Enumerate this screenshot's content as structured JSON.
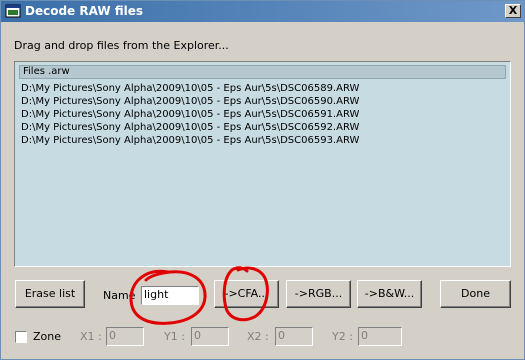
{
  "window": {
    "title": "Decode RAW files",
    "close_glyph": "X"
  },
  "hint": "Drag and drop files from the Explorer...",
  "list": {
    "header": "Files .arw",
    "files": [
      "D:\\My Pictures\\Sony Alpha\\2009\\10\\05 - Eps Aur\\5s\\DSC06589.ARW",
      "D:\\My Pictures\\Sony Alpha\\2009\\10\\05 - Eps Aur\\5s\\DSC06590.ARW",
      "D:\\My Pictures\\Sony Alpha\\2009\\10\\05 - Eps Aur\\5s\\DSC06591.ARW",
      "D:\\My Pictures\\Sony Alpha\\2009\\10\\05 - Eps Aur\\5s\\DSC06592.ARW",
      "D:\\My Pictures\\Sony Alpha\\2009\\10\\05 - Eps Aur\\5s\\DSC06593.ARW"
    ]
  },
  "controls": {
    "erase_label": "Erase list",
    "name_label": "Name",
    "name_value": "light",
    "cfa_label": "->CFA...",
    "rgb_label": "->RGB...",
    "bw_label": "->B&W...",
    "done_label": "Done"
  },
  "zone": {
    "label": "Zone",
    "checked": false,
    "x1_label": "X1 :",
    "x1_value": "0",
    "y1_label": "Y1 :",
    "y1_value": "0",
    "x2_label": "X2 :",
    "x2_value": "0",
    "y2_label": "Y2 :",
    "y2_value": "0"
  },
  "colors": {
    "annotation": "#e00000",
    "list_bg": "#c7dbe2",
    "title_bg": "#3a6fa8"
  },
  "icons": {
    "app": "window-app-icon",
    "close": "close-icon"
  }
}
